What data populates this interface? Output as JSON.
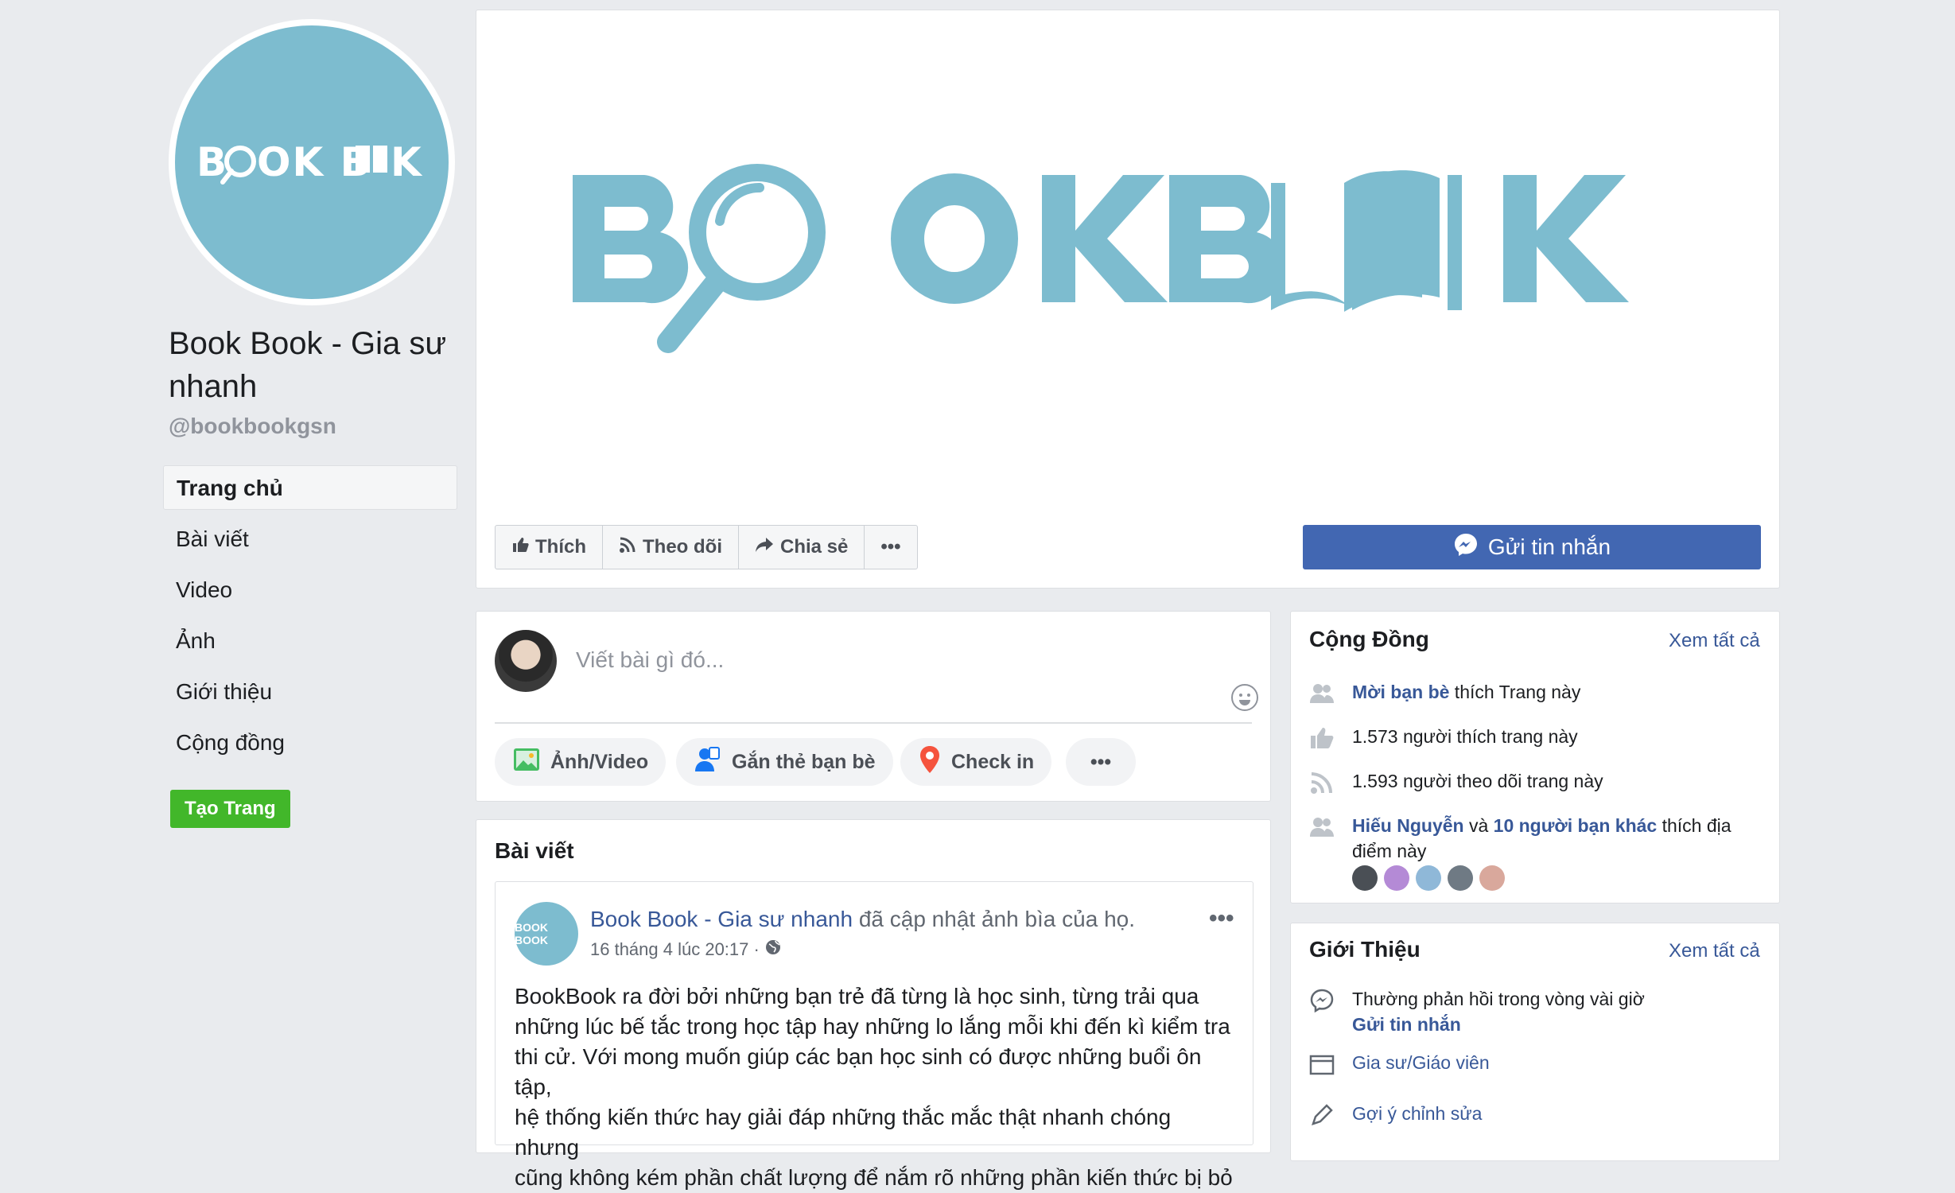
{
  "page": {
    "name": "Book Book - Gia sư nhanh",
    "handle": "@bookbookgsn",
    "logo_text": "BOOK BOOK"
  },
  "nav": {
    "items": [
      {
        "label": "Trang chủ"
      },
      {
        "label": "Bài viết"
      },
      {
        "label": "Video"
      },
      {
        "label": "Ảnh"
      },
      {
        "label": "Giới thiệu"
      },
      {
        "label": "Cộng đồng"
      }
    ],
    "create_page": "Tạo Trang"
  },
  "actions": {
    "like": "Thích",
    "follow": "Theo dõi",
    "share": "Chia sẻ",
    "more": "•••",
    "send_message": "Gửi tin nhắn"
  },
  "composer": {
    "placeholder": "Viết bài gì đó...",
    "photo_video": "Ảnh/Video",
    "tag_friends": "Gắn thẻ bạn bè",
    "check_in": "Check in",
    "more": "•••"
  },
  "feed": {
    "title": "Bài viết",
    "post": {
      "author": "Book Book - Gia sư nhanh",
      "action": "đã cập nhật ảnh bìa của họ.",
      "time": "16 tháng 4 lúc 20:17 ·",
      "body_lines": [
        "BookBook ra đời bởi những bạn trẻ đã từng là học sinh, từng trải qua",
        "những lúc bế tắc trong học tập hay những lo lắng mỗi khi đến kì kiểm tra",
        "thi cử. Với mong muốn giúp các bạn học sinh có được những buổi ôn tập,",
        "hệ thống kiến thức hay giải đáp những thắc mắc thật nhanh chóng nhưng",
        "cũng không kém phần chất lượng để nắm rõ những phần kiến thức bị bỏ"
      ]
    }
  },
  "community": {
    "title": "Cộng Đồng",
    "see_all": "Xem tất cả",
    "invite_link": "Mời bạn bè",
    "invite_rest": " thích Trang này",
    "likes": "1.573 người thích trang này",
    "follows": "1.593 người theo dõi trang này",
    "friend_name": "Hiếu Nguyễn",
    "friend_and": " và ",
    "friend_others": "10 người bạn khác",
    "friend_rest": " thích địa",
    "friend_rest2": "điểm này"
  },
  "about": {
    "title": "Giới Thiệu",
    "see_all": "Xem tất cả",
    "response": "Thường phản hồi trong vòng vài giờ",
    "send_message": "Gửi tin nhắn",
    "category": "Gia sư/Giáo viên",
    "suggest_edit": "Gợi ý chỉnh sửa"
  },
  "colors": {
    "brand_teal": "#7dbccf",
    "fb_blue": "#4267b2",
    "link_blue": "#385898",
    "green": "#42b72a"
  }
}
